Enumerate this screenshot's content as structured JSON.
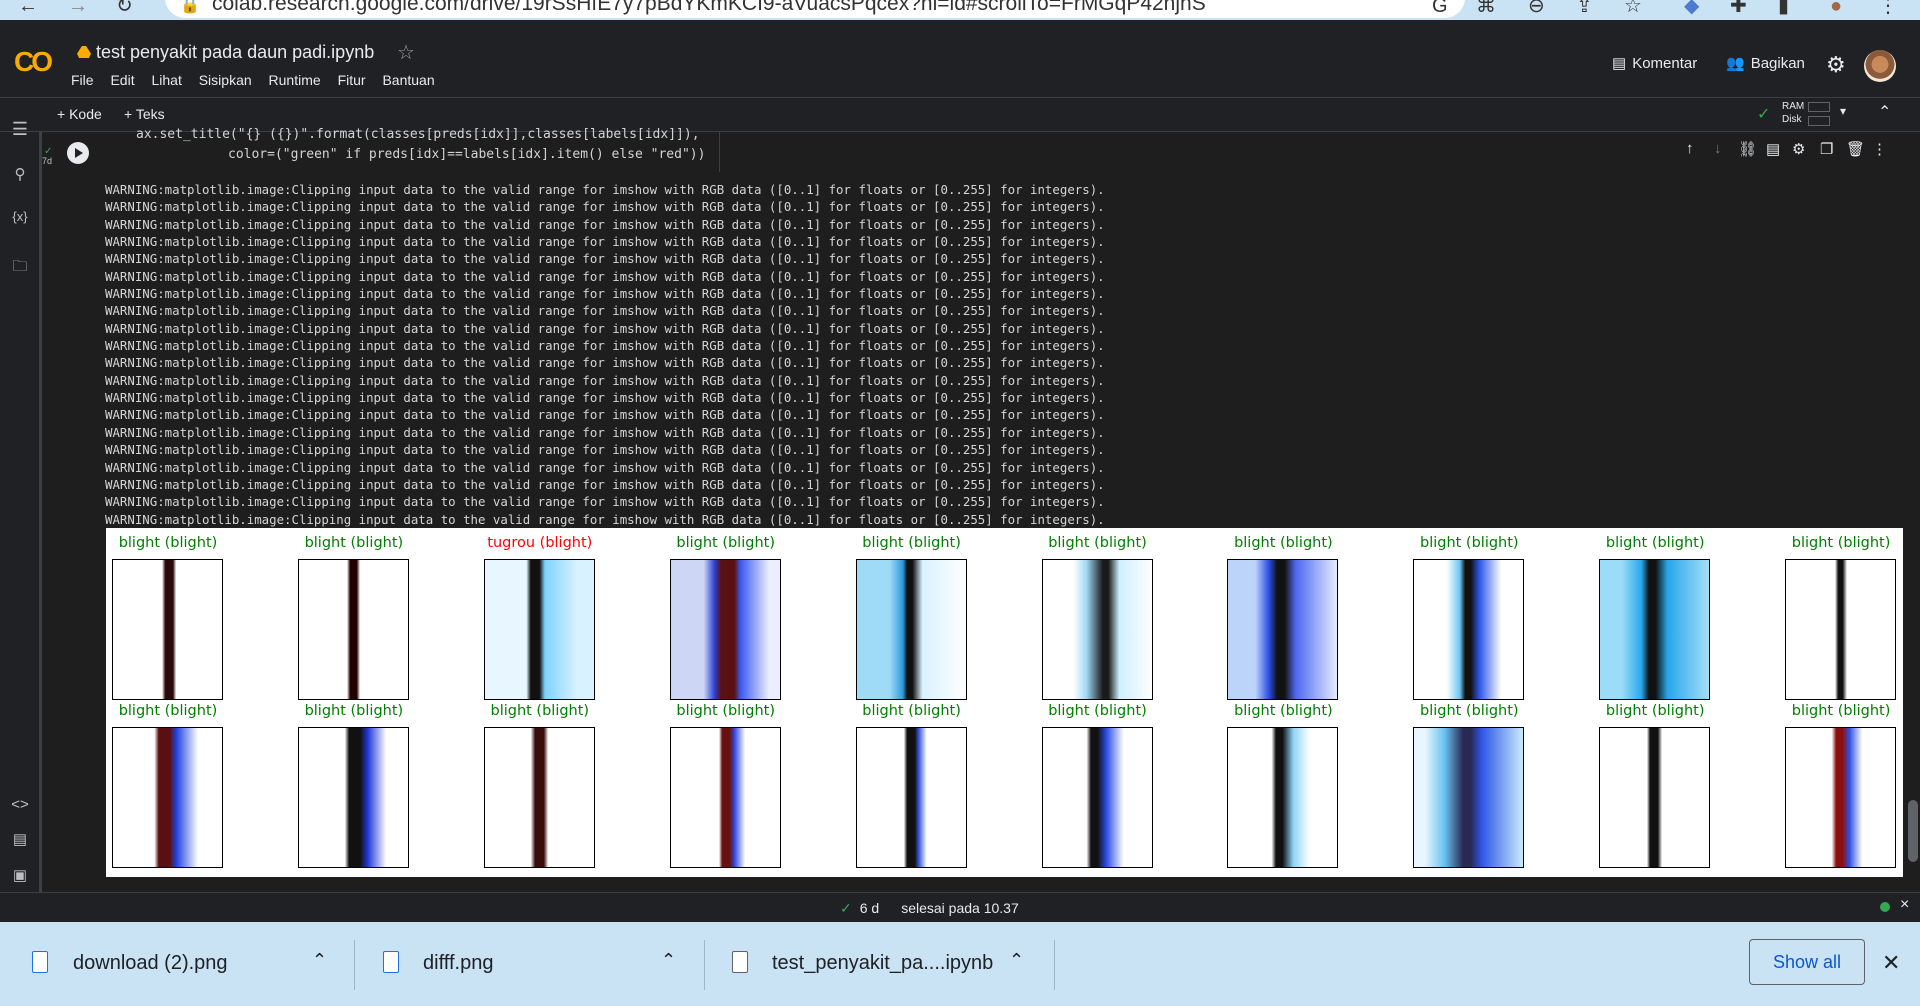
{
  "browser": {
    "url": "colab.research.google.com/drive/19rSsHfE7y7pBdYKmKCI9-aVuacsPqcex?hl=id#scrollTo=FrMGqP42njnS"
  },
  "header": {
    "title": "test penyakit pada daun padi.ipynb",
    "menu": [
      "File",
      "Edit",
      "Lihat",
      "Sisipkan",
      "Runtime",
      "Fitur",
      "Bantuan"
    ],
    "comment_label": "Komentar",
    "share_label": "Bagikan"
  },
  "toolbar": {
    "add_code": "+ Kode",
    "add_text": "+ Teks",
    "ram": "RAM",
    "disk": "Disk"
  },
  "cell": {
    "exec_count": "7d",
    "code_line1": "ax.set_title(\"{} ({})\".format(classes[preds[idx]],classes[labels[idx]]),",
    "code_line2": "color=(\"green\" if preds[idx]==labels[idx].item() else \"red\"))"
  },
  "output": {
    "warning": "WARNING:matplotlib.image:Clipping input data to the valid range for imshow with RGB data ([0..1] for floats or [0..255] for integers).",
    "warning_count": 20
  },
  "figure": {
    "titles": [
      "blight (blight)",
      "blight (blight)",
      "tugrou (blight)",
      "blight (blight)",
      "blight (blight)",
      "blight (blight)",
      "blight (blight)",
      "blight (blight)",
      "blight (blight)",
      "blight (blight)",
      "blight (blight)",
      "blight (blight)",
      "blight (blight)",
      "blight (blight)",
      "blight (blight)",
      "blight (blight)",
      "blight (blight)",
      "blight (blight)",
      "blight (blight)",
      "blight (blight)"
    ],
    "correct": [
      true,
      true,
      false,
      true,
      true,
      true,
      true,
      true,
      true,
      true,
      true,
      true,
      true,
      true,
      true,
      true,
      true,
      true,
      true,
      true
    ],
    "colors": {
      "correct": "#008000",
      "wrong": "#ff0000"
    }
  },
  "status": {
    "duration": "6 d",
    "finished": "selesai pada 10.37"
  },
  "downloads": {
    "items": [
      "download (2).png",
      "difff.png",
      "test_penyakit_pa....ipynb"
    ],
    "show_all": "Show all"
  }
}
